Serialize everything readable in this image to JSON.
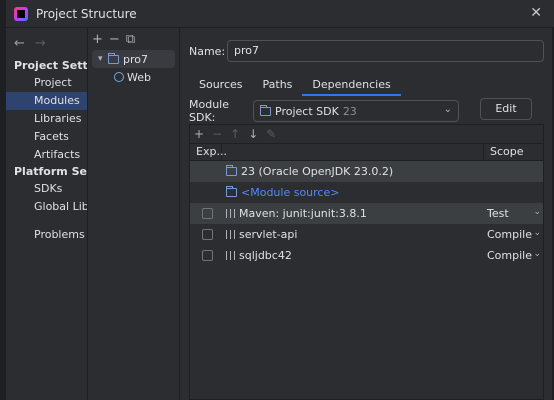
{
  "window": {
    "title": "Project Structure",
    "close_glyph": "✕"
  },
  "nav": {
    "back_glyph": "←",
    "forward_glyph": "→",
    "project_settings_header": "Project Settings",
    "project_settings_items": [
      "Project",
      "Modules",
      "Libraries",
      "Facets",
      "Artifacts"
    ],
    "platform_settings_header": "Platform Settings",
    "platform_settings_items": [
      "SDKs",
      "Global Librar"
    ],
    "problems": "Problems",
    "selected": "Modules"
  },
  "tree": {
    "toolbar": [
      "+",
      "−",
      "⧉"
    ],
    "module": "pro7",
    "child": "Web"
  },
  "main": {
    "name_label": "Name:",
    "name_value": "pro7",
    "tabs": [
      "Sources",
      "Paths",
      "Dependencies"
    ],
    "active_tab": "Dependencies",
    "sdk_label": "Module SDK:",
    "sdk_value": "Project SDK",
    "sdk_version": "23",
    "edit_button": "Edit",
    "dep_toolbar": [
      "+",
      "−",
      "↑",
      "↓",
      "✎"
    ],
    "columns": {
      "export": "Exp...",
      "scope": "Scope"
    },
    "dependencies": [
      {
        "name": "23 (Oracle OpenJDK 23.0.2)",
        "scope": "",
        "checkbox": false,
        "kind": "sdk"
      },
      {
        "name": "<Module source>",
        "scope": "",
        "checkbox": false,
        "kind": "source"
      },
      {
        "name": "Maven: junit:junit:3.8.1",
        "scope": "Test",
        "checkbox": true,
        "kind": "lib"
      },
      {
        "name": "servlet-api",
        "scope": "Compile",
        "checkbox": true,
        "kind": "lib"
      },
      {
        "name": "sqljdbc42",
        "scope": "Compile",
        "checkbox": true,
        "kind": "lib"
      }
    ]
  },
  "colors": {
    "accent": "#3574f0",
    "selection": "#2e436e",
    "link": "#548af7"
  }
}
